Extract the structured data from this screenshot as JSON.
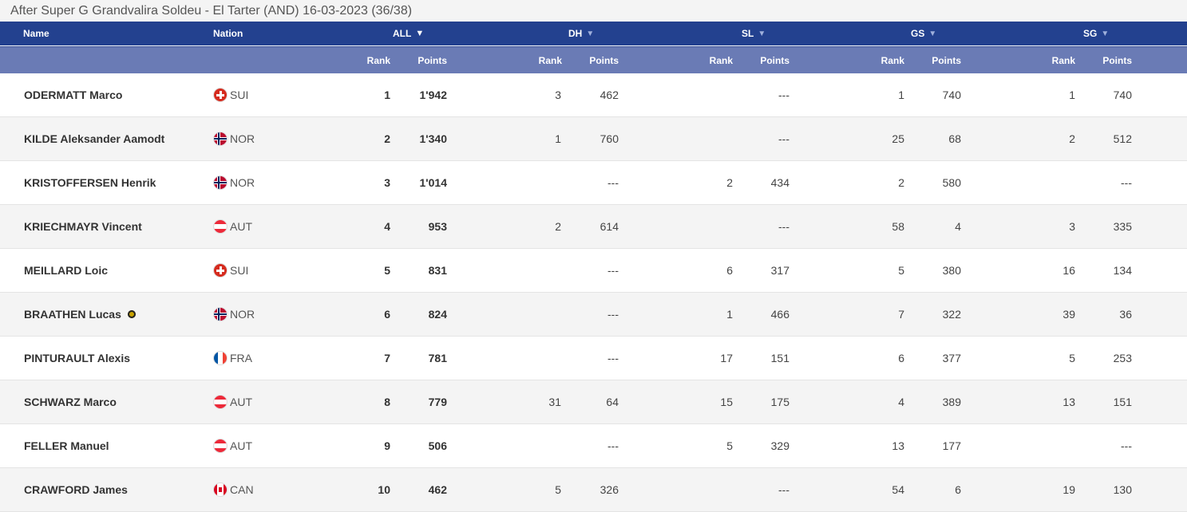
{
  "caption": "After Super G Grandvalira Soldeu - El Tarter (AND) 16-03-2023 (36/38)",
  "header": {
    "name": "Name",
    "nation": "Nation",
    "all": "ALL",
    "dh": "DH",
    "sl": "SL",
    "gs": "GS",
    "sg": "SG",
    "rank": "Rank",
    "points": "Points",
    "sort_arrow": "▼"
  },
  "rows": [
    {
      "name": "ODERMATT Marco",
      "nation": "SUI",
      "all_rank": "1",
      "all_points": "1'942",
      "dh_rank": "3",
      "dh_points": "462",
      "sl_rank": "",
      "sl_points": "---",
      "gs_rank": "1",
      "gs_points": "740",
      "sg_rank": "1",
      "sg_points": "740"
    },
    {
      "name": "KILDE Aleksander Aamodt",
      "nation": "NOR",
      "all_rank": "2",
      "all_points": "1'340",
      "dh_rank": "1",
      "dh_points": "760",
      "sl_rank": "",
      "sl_points": "---",
      "gs_rank": "25",
      "gs_points": "68",
      "sg_rank": "2",
      "sg_points": "512"
    },
    {
      "name": "KRISTOFFERSEN Henrik",
      "nation": "NOR",
      "all_rank": "3",
      "all_points": "1'014",
      "dh_rank": "",
      "dh_points": "---",
      "sl_rank": "2",
      "sl_points": "434",
      "gs_rank": "2",
      "gs_points": "580",
      "sg_rank": "",
      "sg_points": "---"
    },
    {
      "name": "KRIECHMAYR Vincent",
      "nation": "AUT",
      "all_rank": "4",
      "all_points": "953",
      "dh_rank": "2",
      "dh_points": "614",
      "sl_rank": "",
      "sl_points": "---",
      "gs_rank": "58",
      "gs_points": "4",
      "sg_rank": "3",
      "sg_points": "335"
    },
    {
      "name": "MEILLARD Loic",
      "nation": "SUI",
      "all_rank": "5",
      "all_points": "831",
      "dh_rank": "",
      "dh_points": "---",
      "sl_rank": "6",
      "sl_points": "317",
      "gs_rank": "5",
      "gs_points": "380",
      "sg_rank": "16",
      "sg_points": "134"
    },
    {
      "name": "BRAATHEN Lucas",
      "nation": "NOR",
      "all_rank": "6",
      "all_points": "824",
      "dh_rank": "",
      "dh_points": "---",
      "sl_rank": "1",
      "sl_points": "466",
      "gs_rank": "7",
      "gs_points": "322",
      "sg_rank": "39",
      "sg_points": "36",
      "badge": "trophy-icon"
    },
    {
      "name": "PINTURAULT Alexis",
      "nation": "FRA",
      "all_rank": "7",
      "all_points": "781",
      "dh_rank": "",
      "dh_points": "---",
      "sl_rank": "17",
      "sl_points": "151",
      "gs_rank": "6",
      "gs_points": "377",
      "sg_rank": "5",
      "sg_points": "253"
    },
    {
      "name": "SCHWARZ Marco",
      "nation": "AUT",
      "all_rank": "8",
      "all_points": "779",
      "dh_rank": "31",
      "dh_points": "64",
      "sl_rank": "15",
      "sl_points": "175",
      "gs_rank": "4",
      "gs_points": "389",
      "sg_rank": "13",
      "sg_points": "151"
    },
    {
      "name": "FELLER Manuel",
      "nation": "AUT",
      "all_rank": "9",
      "all_points": "506",
      "dh_rank": "",
      "dh_points": "---",
      "sl_rank": "5",
      "sl_points": "329",
      "gs_rank": "13",
      "gs_points": "177",
      "sg_rank": "",
      "sg_points": "---"
    },
    {
      "name": "CRAWFORD James",
      "nation": "CAN",
      "all_rank": "10",
      "all_points": "462",
      "dh_rank": "5",
      "dh_points": "326",
      "sl_rank": "",
      "sl_points": "---",
      "gs_rank": "54",
      "gs_points": "6",
      "sg_rank": "19",
      "sg_points": "130"
    }
  ],
  "colors": {
    "header_dark": "#23418f",
    "header_light": "#6a7bb5",
    "row_alt": "#f4f4f4"
  }
}
